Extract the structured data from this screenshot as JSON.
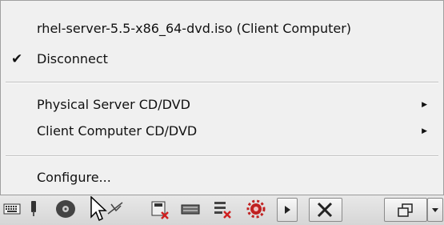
{
  "menu": {
    "items": [
      {
        "label": "rhel-server-5.5-x86_64-dvd.iso (Client Computer)",
        "checked": false,
        "submenu": false
      },
      {
        "label": "Disconnect",
        "checked": true,
        "submenu": false
      },
      {
        "label": "Physical Server CD/DVD",
        "checked": false,
        "submenu": true
      },
      {
        "label": "Client Computer CD/DVD",
        "checked": false,
        "submenu": true
      },
      {
        "label": "Configure...",
        "checked": false,
        "submenu": false
      }
    ],
    "check_glyph": "✔",
    "submenu_glyph": "▶"
  },
  "toolbar": {
    "icons": [
      "keyboard-icon",
      "usb-icon",
      "cd-dvd-icon",
      "floppy-icon",
      "disk-icon",
      "drive-icon",
      "network-icon",
      "settings-icon",
      "play-icon",
      "tools-icon",
      "window-icon",
      "dropdown-icon"
    ]
  }
}
